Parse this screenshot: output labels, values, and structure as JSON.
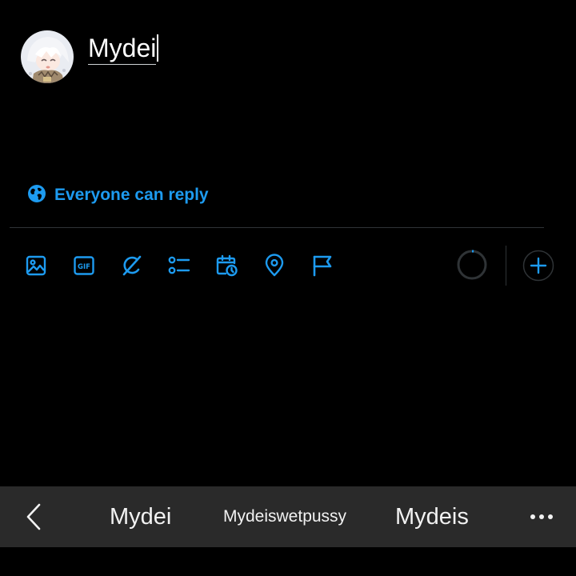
{
  "composer": {
    "text": "Mydei",
    "avatar_icon": "user-avatar"
  },
  "reply_setting": {
    "label": "Everyone can reply",
    "icon": "globe-icon"
  },
  "toolbar": {
    "icons": [
      "image-icon",
      "gif-icon",
      "grok-icon",
      "poll-icon",
      "schedule-icon",
      "location-icon",
      "flag-icon"
    ],
    "char_progress": 0.02,
    "add_icon": "plus-icon"
  },
  "keyboard": {
    "suggestions": [
      "Mydei",
      "Mydeiswetpussy",
      "Mydeis"
    ],
    "back_icon": "chevron-left-icon",
    "more_icon": "more-horizontal-icon"
  },
  "colors": {
    "background": "#000000",
    "accent": "#1d9bf0",
    "divider": "#2f3336",
    "suggestion_bar": "#2a2a2a",
    "text": "#ffffff"
  }
}
